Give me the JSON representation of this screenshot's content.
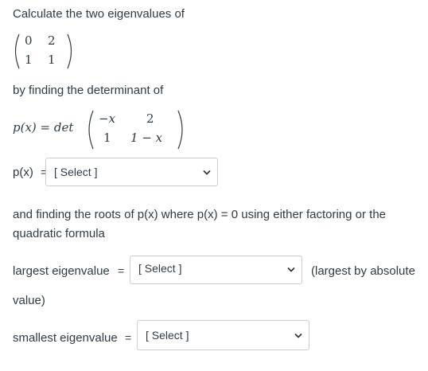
{
  "question": {
    "intro": "Calculate the two eigenvalues of",
    "matrix": {
      "r1c1": "0",
      "r1c2": "2",
      "r2c1": "1",
      "r2c2": "1"
    },
    "by_finding": "by finding the determinant of",
    "px_label_math": "p(x) = det",
    "det_matrix": {
      "r1c1": "−x",
      "r1c2": "2",
      "r2c1": "1",
      "r2c2": "1 − x"
    },
    "px_select_label": "p(x)",
    "roots_text_line1": "and finding the roots of p(x) where p(x) = 0  using either factoring or the",
    "roots_text_line2": "quadratic formula",
    "largest_label": "largest eigenvalue",
    "largest_note_line1": "(largest by absolute",
    "largest_note_line2": "value)",
    "smallest_label": "smallest eigenvalue",
    "equals": "="
  },
  "selects": {
    "px": {
      "selected": "[ Select ]"
    },
    "largest": {
      "selected": "[ Select ]"
    },
    "smallest": {
      "selected": "[ Select ]"
    }
  },
  "icons": {
    "dropdown": "chevron-down-icon"
  }
}
